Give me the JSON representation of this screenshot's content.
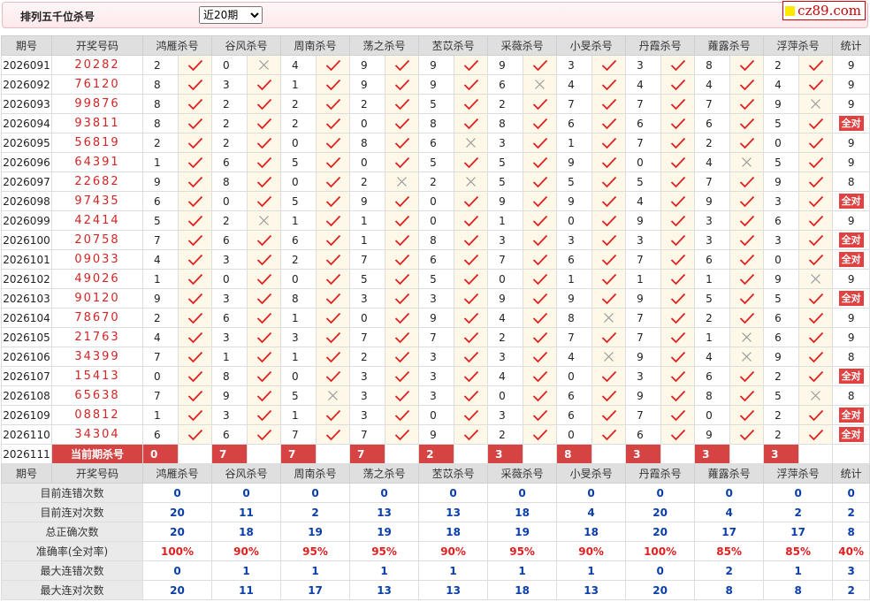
{
  "header": {
    "title": "排列五千位杀号",
    "range_selected": "近20期",
    "logo_text": "cz89.com"
  },
  "columns": {
    "issue": "期号",
    "number": "开奖号码",
    "experts": [
      "鸿雁杀号",
      "谷风杀号",
      "周南杀号",
      "荡之杀号",
      "苤苡杀号",
      "采薇杀号",
      "小旻杀号",
      "丹霞杀号",
      "蕹露杀号",
      "浮萍杀号"
    ],
    "stat": "统计"
  },
  "rows": [
    {
      "issue": "2026091",
      "number": "20282",
      "kills": [
        "2",
        "0",
        "4",
        "9",
        "9",
        "9",
        "3",
        "3",
        "8",
        "2"
      ],
      "ok": [
        1,
        0,
        1,
        1,
        1,
        1,
        1,
        1,
        1,
        1
      ],
      "stat": "9"
    },
    {
      "issue": "2026092",
      "number": "76120",
      "kills": [
        "8",
        "3",
        "1",
        "9",
        "9",
        "6",
        "4",
        "4",
        "4",
        "4"
      ],
      "ok": [
        1,
        1,
        1,
        1,
        1,
        0,
        1,
        1,
        1,
        1
      ],
      "stat": "9"
    },
    {
      "issue": "2026093",
      "number": "99876",
      "kills": [
        "8",
        "2",
        "2",
        "2",
        "5",
        "2",
        "7",
        "7",
        "7",
        "9"
      ],
      "ok": [
        1,
        1,
        1,
        1,
        1,
        1,
        1,
        1,
        1,
        0
      ],
      "stat": "9"
    },
    {
      "issue": "2026094",
      "number": "93811",
      "kills": [
        "8",
        "2",
        "2",
        "0",
        "8",
        "8",
        "6",
        "6",
        "6",
        "5"
      ],
      "ok": [
        1,
        1,
        1,
        1,
        1,
        1,
        1,
        1,
        1,
        1
      ],
      "stat": "全对"
    },
    {
      "issue": "2026095",
      "number": "56819",
      "kills": [
        "2",
        "2",
        "0",
        "8",
        "6",
        "3",
        "1",
        "7",
        "2",
        "0"
      ],
      "ok": [
        1,
        1,
        1,
        1,
        0,
        1,
        1,
        1,
        1,
        1
      ],
      "stat": "9"
    },
    {
      "issue": "2026096",
      "number": "64391",
      "kills": [
        "1",
        "6",
        "5",
        "0",
        "5",
        "5",
        "9",
        "0",
        "4",
        "5"
      ],
      "ok": [
        1,
        1,
        1,
        1,
        1,
        1,
        1,
        1,
        0,
        1
      ],
      "stat": "9"
    },
    {
      "issue": "2026097",
      "number": "22682",
      "kills": [
        "9",
        "8",
        "0",
        "2",
        "2",
        "5",
        "5",
        "5",
        "7",
        "9"
      ],
      "ok": [
        1,
        1,
        1,
        0,
        0,
        1,
        1,
        1,
        1,
        1
      ],
      "stat": "8"
    },
    {
      "issue": "2026098",
      "number": "97435",
      "kills": [
        "6",
        "0",
        "5",
        "9",
        "0",
        "9",
        "9",
        "4",
        "9",
        "3"
      ],
      "ok": [
        1,
        1,
        1,
        1,
        1,
        1,
        1,
        1,
        1,
        1
      ],
      "stat": "全对"
    },
    {
      "issue": "2026099",
      "number": "42414",
      "kills": [
        "5",
        "2",
        "1",
        "1",
        "0",
        "1",
        "0",
        "9",
        "3",
        "6"
      ],
      "ok": [
        1,
        0,
        1,
        1,
        1,
        1,
        1,
        1,
        1,
        1
      ],
      "stat": "9"
    },
    {
      "issue": "2026100",
      "number": "20758",
      "kills": [
        "7",
        "6",
        "6",
        "1",
        "8",
        "3",
        "3",
        "3",
        "3",
        "3"
      ],
      "ok": [
        1,
        1,
        1,
        1,
        1,
        1,
        1,
        1,
        1,
        1
      ],
      "stat": "全对"
    },
    {
      "issue": "2026101",
      "number": "09033",
      "kills": [
        "4",
        "3",
        "2",
        "7",
        "6",
        "7",
        "6",
        "7",
        "6",
        "0"
      ],
      "ok": [
        1,
        1,
        1,
        1,
        1,
        1,
        1,
        1,
        1,
        1
      ],
      "stat": "全对"
    },
    {
      "issue": "2026102",
      "number": "49026",
      "kills": [
        "1",
        "0",
        "0",
        "5",
        "5",
        "0",
        "1",
        "1",
        "1",
        "9"
      ],
      "ok": [
        1,
        1,
        1,
        1,
        1,
        1,
        1,
        1,
        1,
        0
      ],
      "stat": "9"
    },
    {
      "issue": "2026103",
      "number": "90120",
      "kills": [
        "9",
        "3",
        "8",
        "3",
        "3",
        "9",
        "9",
        "9",
        "5",
        "5"
      ],
      "ok": [
        1,
        1,
        1,
        1,
        1,
        1,
        1,
        1,
        1,
        1
      ],
      "stat": "全对"
    },
    {
      "issue": "2026104",
      "number": "78670",
      "kills": [
        "2",
        "6",
        "1",
        "0",
        "9",
        "4",
        "8",
        "7",
        "2",
        "6"
      ],
      "ok": [
        1,
        1,
        1,
        1,
        1,
        1,
        0,
        1,
        1,
        1
      ],
      "stat": "9"
    },
    {
      "issue": "2026105",
      "number": "21763",
      "kills": [
        "4",
        "3",
        "3",
        "7",
        "7",
        "2",
        "7",
        "7",
        "1",
        "6"
      ],
      "ok": [
        1,
        1,
        1,
        1,
        1,
        1,
        1,
        1,
        0,
        1
      ],
      "stat": "9"
    },
    {
      "issue": "2026106",
      "number": "34399",
      "kills": [
        "7",
        "1",
        "1",
        "2",
        "3",
        "3",
        "4",
        "9",
        "4",
        "9"
      ],
      "ok": [
        1,
        1,
        1,
        1,
        1,
        1,
        0,
        1,
        0,
        1
      ],
      "stat": "8"
    },
    {
      "issue": "2026107",
      "number": "15413",
      "kills": [
        "0",
        "8",
        "0",
        "3",
        "3",
        "4",
        "0",
        "3",
        "6",
        "2"
      ],
      "ok": [
        1,
        1,
        1,
        1,
        1,
        1,
        1,
        1,
        1,
        1
      ],
      "stat": "全对"
    },
    {
      "issue": "2026108",
      "number": "65638",
      "kills": [
        "7",
        "9",
        "5",
        "3",
        "3",
        "0",
        "6",
        "9",
        "8",
        "5"
      ],
      "ok": [
        1,
        1,
        0,
        1,
        1,
        1,
        1,
        1,
        1,
        0
      ],
      "stat": "8"
    },
    {
      "issue": "2026109",
      "number": "08812",
      "kills": [
        "1",
        "3",
        "1",
        "3",
        "0",
        "3",
        "6",
        "7",
        "0",
        "2"
      ],
      "ok": [
        1,
        1,
        1,
        1,
        1,
        1,
        1,
        1,
        1,
        1
      ],
      "stat": "全对"
    },
    {
      "issue": "2026110",
      "number": "34304",
      "kills": [
        "6",
        "6",
        "7",
        "7",
        "9",
        "2",
        "0",
        "6",
        "9",
        "2"
      ],
      "ok": [
        1,
        1,
        1,
        1,
        1,
        1,
        1,
        1,
        1,
        1
      ],
      "stat": "全对"
    }
  ],
  "current": {
    "issue": "2026111",
    "label": "当前期杀号",
    "kills": [
      "0",
      "7",
      "7",
      "7",
      "2",
      "3",
      "8",
      "3",
      "3",
      "3"
    ]
  },
  "stats": [
    {
      "label": "目前连错次数",
      "values": [
        "0",
        "0",
        "0",
        "0",
        "0",
        "0",
        "0",
        "0",
        "0",
        "0"
      ],
      "stat": "0"
    },
    {
      "label": "目前连对次数",
      "values": [
        "20",
        "11",
        "2",
        "13",
        "13",
        "18",
        "4",
        "20",
        "4",
        "2"
      ],
      "stat": "2"
    },
    {
      "label": "总正确次数",
      "values": [
        "20",
        "18",
        "19",
        "19",
        "18",
        "19",
        "18",
        "20",
        "17",
        "17"
      ],
      "stat": "8"
    },
    {
      "label": "准确率(全对率)",
      "values": [
        "100%",
        "90%",
        "95%",
        "95%",
        "90%",
        "95%",
        "90%",
        "100%",
        "85%",
        "85%"
      ],
      "stat": "40%",
      "red": true
    },
    {
      "label": "最大连错次数",
      "values": [
        "0",
        "1",
        "1",
        "1",
        "1",
        "1",
        "1",
        "0",
        "2",
        "1"
      ],
      "stat": "3"
    },
    {
      "label": "最大连对次数",
      "values": [
        "20",
        "11",
        "17",
        "13",
        "13",
        "18",
        "13",
        "20",
        "8",
        "8"
      ],
      "stat": "2"
    }
  ],
  "colors": {
    "check": "#e02020",
    "cross": "#999999",
    "accent": "#d54343",
    "stat_blue": "#0a3ea8"
  },
  "icons": {
    "correct": "check-icon",
    "wrong": "cross-icon"
  }
}
